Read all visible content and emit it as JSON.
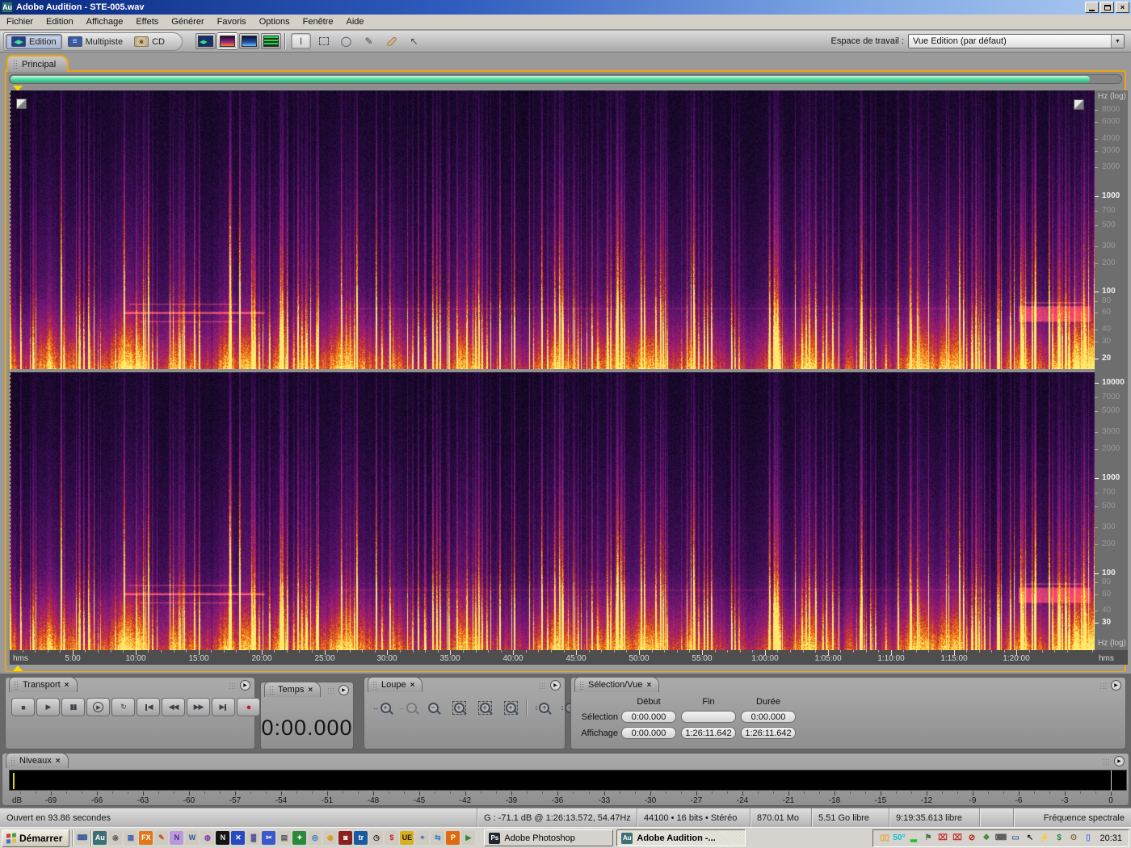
{
  "ui": {
    "close_glyph": "×",
    "hz_header": "Hz (log)",
    "hms": "hms",
    "db_unit": "dB",
    "menu_glyph": "▶"
  },
  "colors": {
    "accent_orange": "#efa50a",
    "scrollbar_green": "#5be0a6",
    "playhead_yellow": "#f2de00",
    "record_red": "#c22222",
    "titlebar_blue": "#0b2a80"
  },
  "window": {
    "title": "Adobe Audition - STE-005.wav",
    "icon_text": "Au"
  },
  "menu_bar": {
    "items": [
      "Fichier",
      "Edition",
      "Affichage",
      "Effets",
      "Générer",
      "Favoris",
      "Options",
      "Fenêtre",
      "Aide"
    ]
  },
  "toolbar": {
    "mode_buttons": [
      {
        "label": "Edition",
        "icon": "edition",
        "active": true
      },
      {
        "label": "Multipiste",
        "icon": "multitrack",
        "active": false
      },
      {
        "label": "CD",
        "icon": "cd",
        "active": false
      }
    ],
    "view_buttons": [
      {
        "name": "waveform-view-button",
        "kind": "waveform",
        "active": false
      },
      {
        "name": "spectral-view-button",
        "kind": "spectral",
        "active": true
      },
      {
        "name": "spectral-pan-view-button",
        "kind": "pan",
        "active": false
      },
      {
        "name": "phase-view-button",
        "kind": "phase",
        "active": false
      }
    ],
    "tool_buttons": [
      {
        "name": "time-selection-tool",
        "glyph": "I",
        "css": "",
        "active": true
      },
      {
        "name": "marquee-selection-tool",
        "glyph": "",
        "css": "marquee",
        "active": false
      },
      {
        "name": "lasso-selection-tool",
        "glyph": "◯",
        "css": "",
        "active": false
      },
      {
        "name": "effects-paintbrush-tool",
        "glyph": "✎",
        "css": "",
        "active": false
      },
      {
        "name": "spot-healing-tool",
        "glyph": "",
        "css": "bandaid",
        "active": false
      },
      {
        "name": "scrub-tool",
        "glyph": "↖",
        "css": "",
        "active": false
      }
    ],
    "workspace": {
      "label": "Espace de travail :",
      "value": "Vue Edition (par défaut)"
    }
  },
  "main_panel": {
    "tab": "Principal"
  },
  "spectral": {
    "file_duration_text": "1:26:11.642",
    "duration_seconds": 5171.642,
    "channels": [
      {
        "name": "left",
        "labels": [
          {
            "text": "8000",
            "bold": false
          },
          {
            "text": "6000",
            "bold": false
          },
          {
            "text": "4000",
            "bold": false
          },
          {
            "text": "3000",
            "bold": false
          },
          {
            "text": "2000",
            "bold": false
          },
          {
            "text": "1000",
            "bold": true
          },
          {
            "text": "700",
            "bold": false
          },
          {
            "text": "500",
            "bold": false
          },
          {
            "text": "300",
            "bold": false
          },
          {
            "text": "200",
            "bold": false
          },
          {
            "text": "100",
            "bold": true
          },
          {
            "text": "80",
            "bold": false
          },
          {
            "text": "60",
            "bold": false
          },
          {
            "text": "40",
            "bold": false
          },
          {
            "text": "30",
            "bold": false
          },
          {
            "text": "20",
            "bold": true
          }
        ]
      },
      {
        "name": "right",
        "labels": [
          {
            "text": "10000",
            "bold": true
          },
          {
            "text": "7000",
            "bold": false
          },
          {
            "text": "5000",
            "bold": false
          },
          {
            "text": "3000",
            "bold": false
          },
          {
            "text": "2000",
            "bold": false
          },
          {
            "text": "1000",
            "bold": true
          },
          {
            "text": "700",
            "bold": false
          },
          {
            "text": "500",
            "bold": false
          },
          {
            "text": "300",
            "bold": false
          },
          {
            "text": "200",
            "bold": false
          },
          {
            "text": "100",
            "bold": true
          },
          {
            "text": "80",
            "bold": false
          },
          {
            "text": "60",
            "bold": false
          },
          {
            "text": "40",
            "bold": false
          },
          {
            "text": "30",
            "bold": true
          }
        ]
      }
    ],
    "palette_stops": [
      [
        0.0,
        "#06030f"
      ],
      [
        0.12,
        "#150826"
      ],
      [
        0.25,
        "#2d0b45"
      ],
      [
        0.4,
        "#4d1161"
      ],
      [
        0.52,
        "#6e1671"
      ],
      [
        0.62,
        "#8e1c73"
      ],
      [
        0.72,
        "#b12457"
      ],
      [
        0.8,
        "#d24127"
      ],
      [
        0.88,
        "#f07716"
      ],
      [
        0.95,
        "#ffb52a"
      ],
      [
        1.0,
        "#ffea6e"
      ]
    ]
  },
  "timeline": {
    "unit": "hms",
    "labels": [
      {
        "t": 300,
        "text": "5:00"
      },
      {
        "t": 600,
        "text": "10:00"
      },
      {
        "t": 900,
        "text": "15:00"
      },
      {
        "t": 1200,
        "text": "20:00"
      },
      {
        "t": 1500,
        "text": "25:00"
      },
      {
        "t": 1800,
        "text": "30:00"
      },
      {
        "t": 2100,
        "text": "35:00"
      },
      {
        "t": 2400,
        "text": "40:00"
      },
      {
        "t": 2700,
        "text": "45:00"
      },
      {
        "t": 3000,
        "text": "50:00"
      },
      {
        "t": 3300,
        "text": "55:00"
      },
      {
        "t": 3600,
        "text": "1:00:00"
      },
      {
        "t": 3900,
        "text": "1:05:00"
      },
      {
        "t": 4200,
        "text": "1:10:00"
      },
      {
        "t": 4500,
        "text": "1:15:00"
      },
      {
        "t": 4800,
        "text": "1:20:00"
      }
    ]
  },
  "transport": {
    "title": "Transport",
    "buttons": [
      {
        "name": "stop-button",
        "glyph": "■",
        "circled": false,
        "edge": "",
        "record": false
      },
      {
        "name": "play-button",
        "glyph": "▶",
        "circled": false,
        "edge": "",
        "record": false
      },
      {
        "name": "pause-button",
        "glyph": "▮▮",
        "circled": false,
        "edge": "",
        "record": false
      },
      {
        "name": "play-from-cursor-button",
        "glyph": "▶",
        "circled": true,
        "edge": "",
        "record": false
      },
      {
        "name": "loop-play-button",
        "glyph": "↻",
        "circled": false,
        "edge": "",
        "record": false
      },
      {
        "name": "go-to-start-button",
        "glyph": "◀",
        "circled": false,
        "edge": "left",
        "record": false
      },
      {
        "name": "rewind-button",
        "glyph": "◀◀",
        "circled": false,
        "edge": "",
        "record": false
      },
      {
        "name": "fast-forward-button",
        "glyph": "▶▶",
        "circled": false,
        "edge": "",
        "record": false
      },
      {
        "name": "go-to-end-button",
        "glyph": "▶",
        "circled": false,
        "edge": "right",
        "record": false
      },
      {
        "name": "record-button",
        "glyph": "●",
        "circled": false,
        "edge": "",
        "record": true
      }
    ]
  },
  "time_panel": {
    "title": "Temps",
    "value": "0:00.000"
  },
  "zoom_panel": {
    "title": "Loupe",
    "buttons": [
      {
        "name": "zoom-in-horizontal-button",
        "sign": "+",
        "axis": "↔",
        "box": false,
        "disabled": false
      },
      {
        "name": "zoom-out-horizontal-button",
        "sign": "−",
        "axis": "↔",
        "box": false,
        "disabled": true
      },
      {
        "name": "zoom-out-full-button",
        "sign": "−",
        "axis": "",
        "box": false,
        "disabled": false
      },
      {
        "name": "zoom-to-selection-button",
        "sign": "+",
        "axis": "",
        "box": true,
        "disabled": false
      },
      {
        "name": "zoom-selection-left-button",
        "sign": "+",
        "axis": "",
        "box": true,
        "disabled": false
      },
      {
        "name": "zoom-selection-right-button",
        "sign": "+",
        "axis": "",
        "box": true,
        "disabled": false
      },
      {
        "name": "zoom-in-vertical-button",
        "sign": "+",
        "axis": "↕",
        "box": false,
        "disabled": false
      },
      {
        "name": "zoom-out-vertical-button",
        "sign": "−",
        "axis": "↕",
        "box": false,
        "disabled": false
      }
    ]
  },
  "selection_panel": {
    "title": "Sélection/Vue",
    "columns": [
      "Début",
      "Fin",
      "Durée"
    ],
    "rows": [
      {
        "label": "Sélection",
        "debut": "0:00.000",
        "fin": "",
        "duree": "0:00.000"
      },
      {
        "label": "Affichage",
        "debut": "0:00.000",
        "fin": "1:26:11.642",
        "duree": "1:26:11.642"
      }
    ]
  },
  "levels_panel": {
    "title": "Niveaux",
    "unit": "dB",
    "ticks": [
      -69,
      -66,
      -63,
      -60,
      -57,
      -54,
      -51,
      -48,
      -45,
      -42,
      -39,
      -36,
      -33,
      -30,
      -27,
      -24,
      -21,
      -18,
      -15,
      -12,
      -9,
      -6,
      -3,
      0
    ]
  },
  "status_bar": {
    "opened": "Ouvert en 93.86 secondes",
    "cursor_info": "G : -71.1 dB @ 1:26:13.572, 54.47Hz",
    "format": "44100 • 16 bits • Stéréo",
    "file_size": "870.01 Mo",
    "disk_free": "5.51 Go libre",
    "time_free": "9:19:35.613 libre",
    "mode": "Fréquence spectrale"
  },
  "taskbar": {
    "start_label": "Démarrer",
    "quicklaunch": [
      {
        "name": "keyboard-icon",
        "glyph": "⌨",
        "bg": "#cfcbc0",
        "fg": "#3a5a9c"
      },
      {
        "name": "audition-app-icon",
        "glyph": "Au",
        "bg": "#3e6f74",
        "fg": "#ffffff"
      },
      {
        "name": "media-player-icon",
        "glyph": "◉",
        "bg": "#cfcbc0",
        "fg": "#6a6a6a"
      },
      {
        "name": "calculator-icon",
        "glyph": "▦",
        "bg": "#cfcbc0",
        "fg": "#4a66aa"
      },
      {
        "name": "fx-app-icon",
        "glyph": "FX",
        "bg": "#e07818",
        "fg": "#ffffff"
      },
      {
        "name": "painter-icon",
        "glyph": "✎",
        "bg": "#cfcbc0",
        "fg": "#c05010"
      },
      {
        "name": "onenote-icon",
        "glyph": "N",
        "bg": "#b89ad8",
        "fg": "#55288a"
      },
      {
        "name": "word-icon",
        "glyph": "W",
        "bg": "#cfcbc0",
        "fg": "#2a52a2"
      },
      {
        "name": "planet-browser-icon",
        "glyph": "◍",
        "bg": "#cfcbc0",
        "fg": "#7a3ab0"
      },
      {
        "name": "netscape-icon",
        "glyph": "N",
        "bg": "#141414",
        "fg": "#e8e8e8"
      },
      {
        "name": "x-tools-icon",
        "glyph": "✕",
        "bg": "#2a48c0",
        "fg": "#ffffff"
      },
      {
        "name": "pattern-tool-icon",
        "glyph": "▓",
        "bg": "#cfcbc0",
        "fg": "#3a3a8a"
      },
      {
        "name": "snip-tool-icon",
        "glyph": "✂",
        "bg": "#3a5acc",
        "fg": "#ffffff"
      },
      {
        "name": "notes-icon",
        "glyph": "▤",
        "bg": "#cfcbc0",
        "fg": "#555555"
      },
      {
        "name": "green-app-icon",
        "glyph": "✦",
        "bg": "#2a8a3a",
        "fg": "#ffffff"
      },
      {
        "name": "globe-icon",
        "glyph": "◎",
        "bg": "#cfcbc0",
        "fg": "#2a6acc"
      },
      {
        "name": "burn-cd-icon",
        "glyph": "◉",
        "bg": "#cfcbc0",
        "fg": "#d89a20"
      },
      {
        "name": "camera-app-icon",
        "glyph": "◙",
        "bg": "#8a2020",
        "fg": "#ffffff"
      },
      {
        "name": "traktor-icon",
        "glyph": "tr",
        "bg": "#1a5aa0",
        "fg": "#ffffff"
      },
      {
        "name": "timer-icon",
        "glyph": "◷",
        "bg": "#cfcbc0",
        "fg": "#222222"
      },
      {
        "name": "sbp-icon",
        "glyph": "$",
        "bg": "#cfcbc0",
        "fg": "#c02020"
      },
      {
        "name": "ue-icon",
        "glyph": "UE",
        "bg": "#d8b020",
        "fg": "#222222"
      },
      {
        "name": "pointer-app-icon",
        "glyph": "⌖",
        "bg": "#cfcbc0",
        "fg": "#3a6acc"
      },
      {
        "name": "sync-icon",
        "glyph": "⇆",
        "bg": "#cfcbc0",
        "fg": "#2a7ad8"
      },
      {
        "name": "pdf-icon",
        "glyph": "P",
        "bg": "#e06a10",
        "fg": "#ffffff"
      },
      {
        "name": "update-icon",
        "glyph": "▶",
        "bg": "#cfcbc0",
        "fg": "#2a8a3a"
      }
    ],
    "tasks": [
      {
        "label": "Adobe Photoshop",
        "icon_text": "Ps",
        "icon_bg": "#20262c",
        "active": false
      },
      {
        "label": "Adobe Audition -...",
        "icon_text": "Au",
        "icon_bg": "#3e6f74",
        "active": true
      }
    ],
    "tray": [
      {
        "name": "meter-tray-icon",
        "glyph": "▯▯",
        "fg": "#e8a020"
      },
      {
        "name": "temperature-tray-icon",
        "glyph": "50°",
        "fg": "#00c8d8"
      },
      {
        "name": "status-bar-tray-icon",
        "glyph": "▂",
        "fg": "#20c020"
      },
      {
        "name": "flag-tray-icon",
        "glyph": "⚑",
        "fg": "#4a7a4a"
      },
      {
        "name": "network-off-icon",
        "glyph": "⌧",
        "fg": "#c03030"
      },
      {
        "name": "network-off2-icon",
        "glyph": "⌧",
        "fg": "#c03030"
      },
      {
        "name": "blocked-tray-icon",
        "glyph": "⊘",
        "fg": "#b02020"
      },
      {
        "name": "shield-tray-icon",
        "glyph": "❖",
        "fg": "#3a8a3a"
      },
      {
        "name": "input-tray-icon",
        "glyph": "⌨",
        "fg": "#555555"
      },
      {
        "name": "display-tray-icon",
        "glyph": "▭",
        "fg": "#4466aa"
      },
      {
        "name": "cursor-tray-icon",
        "glyph": "↖",
        "fg": "#222222"
      },
      {
        "name": "power-alert-tray-icon",
        "glyph": "⚡",
        "fg": "#d82020"
      },
      {
        "name": "currency-tray-icon",
        "glyph": "$",
        "fg": "#2a8a3a"
      },
      {
        "name": "mouse-tray-icon",
        "glyph": "ʘ",
        "fg": "#8a6a3a"
      },
      {
        "name": "file-tray-icon",
        "glyph": "▯",
        "fg": "#4a7ad8"
      }
    ],
    "clock": "20:31"
  }
}
